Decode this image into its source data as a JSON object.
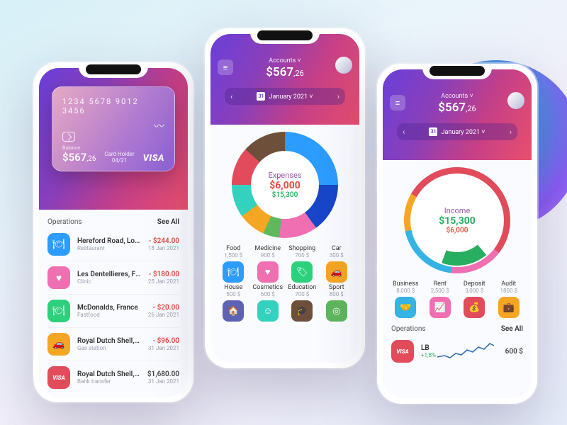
{
  "header": {
    "accounts_label": "Accounts ˅",
    "amount_whole": "$567",
    "amount_cents": ",26",
    "date_label": "January 2021 ˅",
    "calendar_day": "31"
  },
  "card": {
    "number": "1234  5678  9012  3456",
    "balance_label": "Balance",
    "amount_whole": "$567",
    "amount_cents": ",26",
    "holder_label": "Card Holder",
    "expiry": "04/21",
    "brand": "VISA"
  },
  "sections": {
    "operations": "Operations",
    "see_all": "See All"
  },
  "ops1": [
    {
      "title": "Hereford Road, London",
      "sub": "Restaurant",
      "amt": "- $244.00",
      "date": "18 Jan 2021",
      "neg": true,
      "icon": "ic-food",
      "glyph": "🍽"
    },
    {
      "title": "Les Dentellieres, France",
      "sub": "Clinic",
      "amt": "- $180.00",
      "date": "25 Jan 2021",
      "neg": true,
      "icon": "ic-med",
      "glyph": "♥"
    },
    {
      "title": "McDonalds, France",
      "sub": "Fastfood",
      "amt": "- $20.00",
      "date": "26 Jan 2021",
      "neg": true,
      "icon": "ic-shop",
      "glyph": "🍽"
    },
    {
      "title": "Royal Dutch Shell, Italy",
      "sub": "Gas station",
      "amt": "- $96.00",
      "date": "31 Jan 2021",
      "neg": true,
      "icon": "ic-car",
      "glyph": "🚗"
    },
    {
      "title": "Royal Dutch Shell, Italy",
      "sub": "Bank transfer",
      "amt": "$1,680.00",
      "date": "31 Jan 2021",
      "neg": false,
      "icon": "ic-visa",
      "glyph": "VISA"
    }
  ],
  "expenses": {
    "label": "Expenses",
    "primary": "$6,000",
    "secondary": "$15,300",
    "categories": [
      {
        "label": "Food",
        "sub": "1,500 $",
        "icon": "ic-food",
        "glyph": "🍽"
      },
      {
        "label": "Medicine",
        "sub": "900 $",
        "icon": "ic-med",
        "glyph": "♥"
      },
      {
        "label": "Shopping",
        "sub": "700 $",
        "icon": "ic-shop",
        "glyph": "🏷"
      },
      {
        "label": "Car",
        "sub": "300 $",
        "icon": "ic-car",
        "glyph": "🚗"
      },
      {
        "label": "House",
        "sub": "500 $",
        "icon": "ic-house",
        "glyph": "🏠"
      },
      {
        "label": "Cosmetics",
        "sub": "600 $",
        "icon": "ic-cosm",
        "glyph": "☺"
      },
      {
        "label": "Education",
        "sub": "700 $",
        "icon": "ic-edu",
        "glyph": "🎓"
      },
      {
        "label": "Sport",
        "sub": "800 $",
        "icon": "ic-sport",
        "glyph": "◎"
      }
    ]
  },
  "income": {
    "label": "Income",
    "primary": "$15,300",
    "secondary": "$6,000",
    "categories": [
      {
        "label": "Business",
        "sub": "8,000 $",
        "icon": "ic-biz",
        "glyph": "🤝"
      },
      {
        "label": "Rent",
        "sub": "2,500 $",
        "icon": "ic-rent",
        "glyph": "📈"
      },
      {
        "label": "Deposit",
        "sub": "3,000 $",
        "icon": "ic-dep",
        "glyph": "💰"
      },
      {
        "label": "Audit",
        "sub": "1800 $",
        "icon": "ic-audit",
        "glyph": "💼"
      }
    ]
  },
  "ops3": {
    "title": "LB",
    "change": "+1,8%",
    "amount": "600 $"
  },
  "chart_data": [
    {
      "type": "pie",
      "title": "Expenses",
      "series": [
        {
          "name": "Expenses",
          "values": [
            1500,
            900,
            700,
            300,
            500,
            600,
            700,
            800
          ]
        }
      ],
      "categories": [
        "Food",
        "Medicine",
        "Shopping",
        "Car",
        "House",
        "Cosmetics",
        "Education",
        "Sport"
      ],
      "total": 6000,
      "compare_total": 15300
    },
    {
      "type": "pie",
      "title": "Income",
      "series": [
        {
          "name": "Income",
          "values": [
            8000,
            2500,
            3000,
            1800
          ]
        }
      ],
      "categories": [
        "Business",
        "Rent",
        "Deposit",
        "Audit"
      ],
      "total": 15300,
      "compare_total": 6000
    }
  ]
}
